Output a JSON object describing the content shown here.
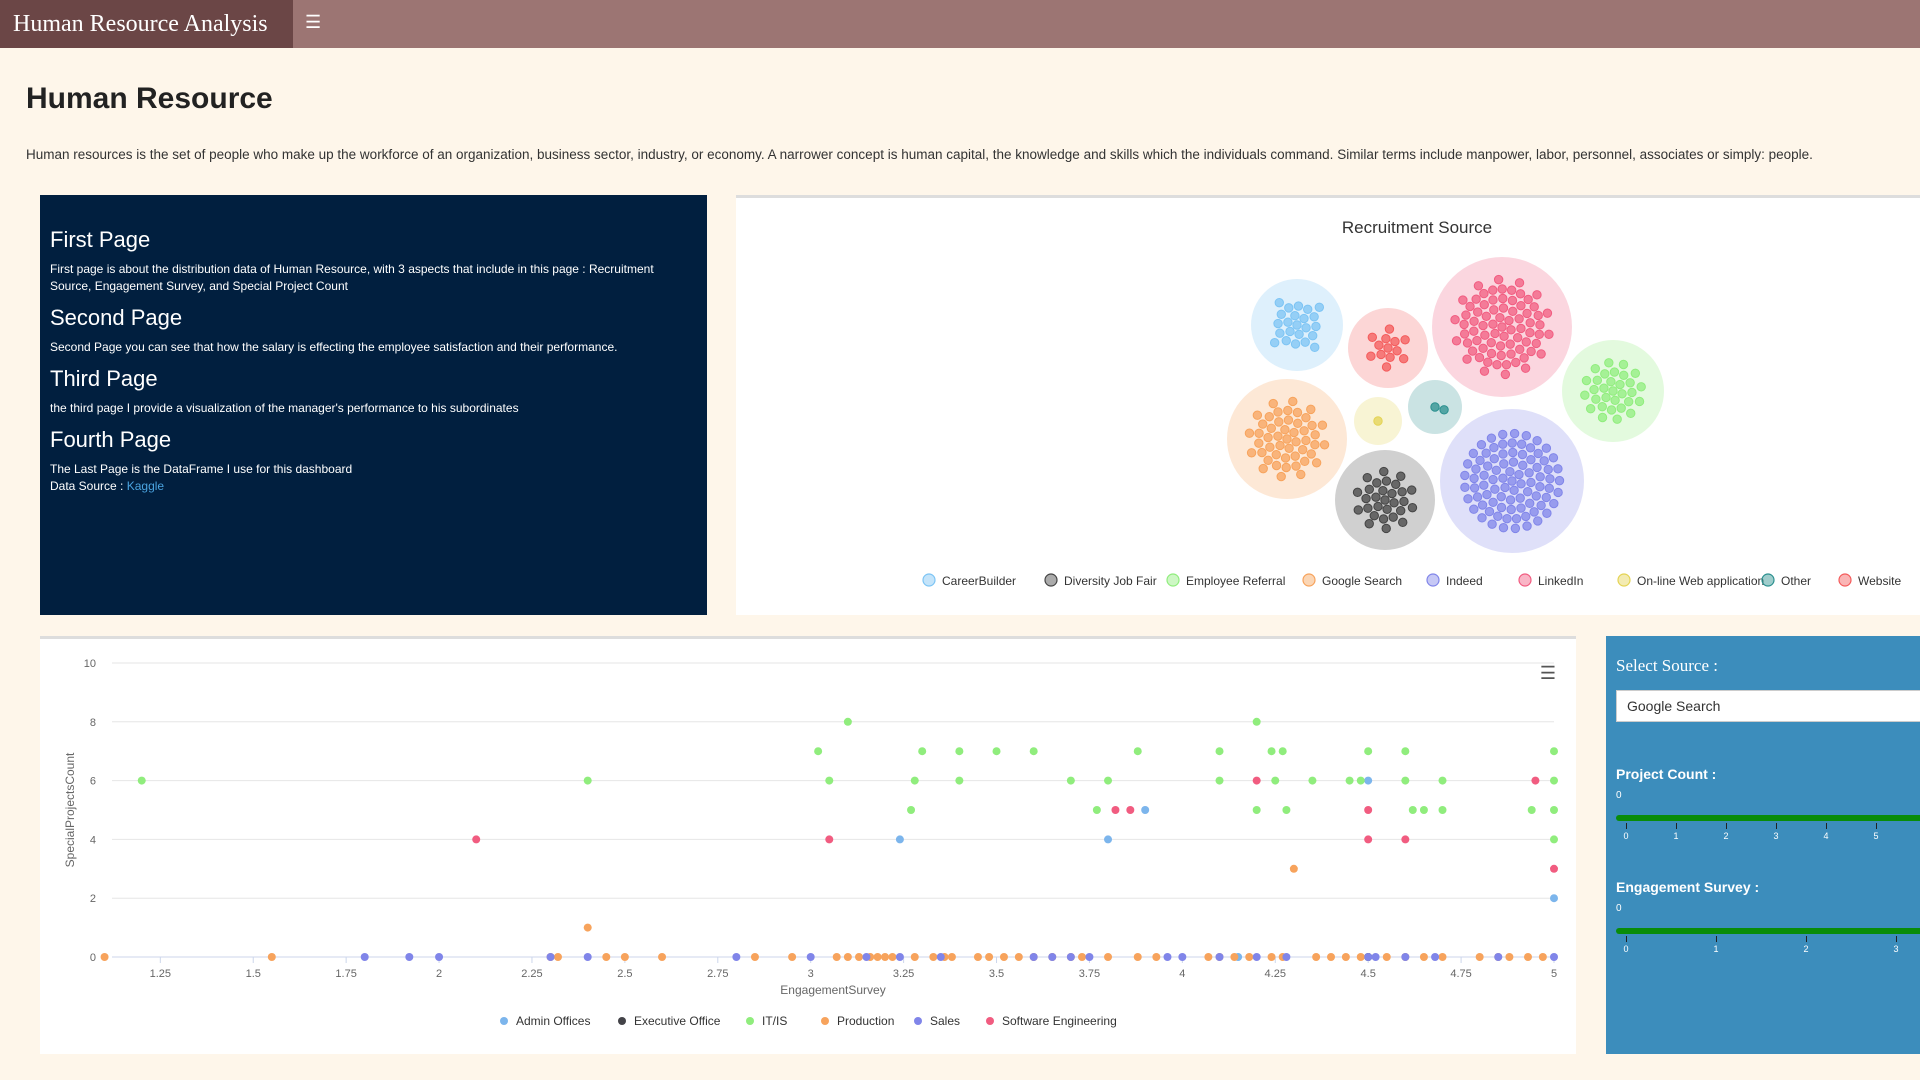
{
  "app": {
    "title": "Human Resource Analysis"
  },
  "page": {
    "title": "Human Resource",
    "intro": "Human resources is the set of people who make up the workforce of an organization, business sector, industry, or economy. A narrower concept is human capital, the knowledge and skills which the individuals command. Similar terms include manpower, labor, personnel, associates or simply: people."
  },
  "info": {
    "first_title": "First Page",
    "first_text": "First page is about the distribution data of Human Resource, with 3 aspects that include in this page : Recruitment Source, Engagement Survey, and Special Project Count",
    "second_title": "Second Page",
    "second_text": "Second Page you can see that how the salary is effecting the employee satisfaction and their performance.",
    "third_title": "Third Page",
    "third_text": "the third page I provide a visualization of the manager's performance to his subordinates",
    "fourth_title": "Fourth Page",
    "fourth_text": "The Last Page is the DataFrame I use for this dashboard",
    "source_label": "Data Source : ",
    "source_link": "Kaggle"
  },
  "controls": {
    "select_title": "Select Source :",
    "selected_source": "Google Search",
    "project_label": "Project Count :",
    "project_value": "0",
    "project_ticks": [
      "0",
      "1",
      "2",
      "3",
      "4",
      "5"
    ],
    "engagement_label": "Engagement Survey :",
    "engagement_value": "0",
    "engagement_ticks": [
      "0",
      "1",
      "2",
      "3"
    ]
  },
  "chart_data": [
    {
      "type": "packed-bubble",
      "title": "Recruitment Source",
      "series": [
        {
          "name": "CareerBuilder",
          "color": "#7cc4f4",
          "count": 23
        },
        {
          "name": "Diversity Job Fair",
          "color": "#444444",
          "count": 29
        },
        {
          "name": "Employee Referral",
          "color": "#90ed7d",
          "count": 31
        },
        {
          "name": "Google Search",
          "color": "#f7a35c",
          "count": 49
        },
        {
          "name": "Indeed",
          "color": "#8085e9",
          "count": 87
        },
        {
          "name": "LinkedIn",
          "color": "#f15c80",
          "count": 76
        },
        {
          "name": "On-line Web application",
          "color": "#e4d354",
          "count": 1
        },
        {
          "name": "Other",
          "color": "#2b908f",
          "count": 2
        },
        {
          "name": "Website",
          "color": "#f45b5b",
          "count": 13
        }
      ]
    },
    {
      "type": "scatter",
      "xlabel": "EngagementSurvey",
      "ylabel": "SpecialProjectsCount",
      "xlim": [
        1.12,
        5
      ],
      "ylim": [
        0,
        10
      ],
      "x_ticks": [
        "1.25",
        "1.5",
        "1.75",
        "2",
        "2.25",
        "2.5",
        "2.75",
        "3",
        "3.25",
        "3.5",
        "3.75",
        "4",
        "4.25",
        "4.5",
        "4.75",
        "5"
      ],
      "y_ticks": [
        "0",
        "2",
        "4",
        "6",
        "8",
        "10"
      ],
      "legend_position": "bottom",
      "series": [
        {
          "name": "Admin Offices",
          "color": "#7cb5ec",
          "points": [
            [
              3.24,
              4
            ],
            [
              3.8,
              4
            ],
            [
              4.5,
              6
            ],
            [
              5,
              2
            ],
            [
              3.9,
              5
            ],
            [
              4.5,
              0
            ],
            [
              4.15,
              0
            ]
          ]
        },
        {
          "name": "Executive Office",
          "color": "#434348",
          "points": [
            [
              4.5,
              0
            ]
          ]
        },
        {
          "name": "IT/IS",
          "color": "#90ed7d",
          "points": [
            [
              1.2,
              6
            ],
            [
              2.4,
              6
            ],
            [
              3.1,
              8
            ],
            [
              3.02,
              7
            ],
            [
              3.05,
              6
            ],
            [
              3.3,
              7
            ],
            [
              3.4,
              7
            ],
            [
              3.5,
              7
            ],
            [
              3.6,
              7
            ],
            [
              3.88,
              7
            ],
            [
              4.1,
              7
            ],
            [
              4.2,
              8
            ],
            [
              4.24,
              7
            ],
            [
              4.27,
              7
            ],
            [
              4.5,
              7
            ],
            [
              4.6,
              7
            ],
            [
              5,
              7
            ],
            [
              3.28,
              6
            ],
            [
              3.4,
              6
            ],
            [
              3.7,
              6
            ],
            [
              3.8,
              6
            ],
            [
              4.1,
              6
            ],
            [
              4.25,
              6
            ],
            [
              4.35,
              6
            ],
            [
              4.45,
              6
            ],
            [
              4.48,
              6
            ],
            [
              4.6,
              6
            ],
            [
              4.7,
              6
            ],
            [
              5,
              6
            ],
            [
              3.27,
              5
            ],
            [
              3.77,
              5
            ],
            [
              4.2,
              5
            ],
            [
              4.28,
              5
            ],
            [
              4.62,
              5
            ],
            [
              4.65,
              5
            ],
            [
              4.7,
              5
            ],
            [
              4.94,
              5
            ],
            [
              5,
              5
            ],
            [
              5,
              4
            ]
          ]
        },
        {
          "name": "Production",
          "color": "#f7a35c",
          "points": [
            [
              1.1,
              0
            ],
            [
              1.55,
              0
            ],
            [
              2.3,
              0
            ],
            [
              2.32,
              0
            ],
            [
              2.4,
              1
            ],
            [
              2.45,
              0
            ],
            [
              2.5,
              0
            ],
            [
              2.6,
              0
            ],
            [
              2.85,
              0
            ],
            [
              2.95,
              0
            ],
            [
              3.07,
              0
            ],
            [
              3.1,
              0
            ],
            [
              3.13,
              0
            ],
            [
              3.16,
              0
            ],
            [
              3.18,
              0
            ],
            [
              3.2,
              0
            ],
            [
              3.22,
              0
            ],
            [
              3.28,
              0
            ],
            [
              3.33,
              0
            ],
            [
              3.36,
              0
            ],
            [
              3.38,
              0
            ],
            [
              3.45,
              0
            ],
            [
              3.48,
              0
            ],
            [
              3.52,
              0
            ],
            [
              3.56,
              0
            ],
            [
              3.6,
              0
            ],
            [
              3.65,
              0
            ],
            [
              3.7,
              0
            ],
            [
              3.73,
              0
            ],
            [
              3.8,
              0
            ],
            [
              3.88,
              0
            ],
            [
              3.93,
              0
            ],
            [
              4.07,
              0
            ],
            [
              4.1,
              0
            ],
            [
              4.14,
              0
            ],
            [
              4.18,
              0
            ],
            [
              4.24,
              0
            ],
            [
              4.27,
              0
            ],
            [
              4.3,
              3
            ],
            [
              4.36,
              0
            ],
            [
              4.4,
              0
            ],
            [
              4.44,
              0
            ],
            [
              4.48,
              0
            ],
            [
              4.55,
              0
            ],
            [
              4.6,
              0
            ],
            [
              4.65,
              0
            ],
            [
              4.7,
              0
            ],
            [
              4.8,
              0
            ],
            [
              4.85,
              0
            ],
            [
              4.88,
              0
            ],
            [
              4.93,
              0
            ],
            [
              4.97,
              0
            ]
          ]
        },
        {
          "name": "Sales",
          "color": "#8085e9",
          "points": [
            [
              1.8,
              0
            ],
            [
              1.92,
              0
            ],
            [
              2,
              0
            ],
            [
              2.3,
              0
            ],
            [
              2.4,
              0
            ],
            [
              2.8,
              0
            ],
            [
              3,
              0
            ],
            [
              3.15,
              0
            ],
            [
              3.24,
              0
            ],
            [
              3.35,
              0
            ],
            [
              3.6,
              0
            ],
            [
              3.65,
              0
            ],
            [
              3.7,
              0
            ],
            [
              3.75,
              0
            ],
            [
              3.96,
              0
            ],
            [
              4,
              0
            ],
            [
              4.1,
              0
            ],
            [
              4.2,
              0
            ],
            [
              4.28,
              0
            ],
            [
              4.5,
              0
            ],
            [
              4.52,
              0
            ],
            [
              4.6,
              0
            ],
            [
              4.68,
              0
            ],
            [
              4.85,
              0
            ],
            [
              5,
              0
            ]
          ]
        },
        {
          "name": "Software Engineering",
          "color": "#f15c80",
          "points": [
            [
              2.1,
              4
            ],
            [
              3.05,
              4
            ],
            [
              3.82,
              5
            ],
            [
              3.86,
              5
            ],
            [
              4.2,
              6
            ],
            [
              4.5,
              5
            ],
            [
              4.5,
              4
            ],
            [
              4.6,
              4
            ],
            [
              4.95,
              6
            ],
            [
              5,
              3
            ]
          ]
        }
      ]
    }
  ]
}
